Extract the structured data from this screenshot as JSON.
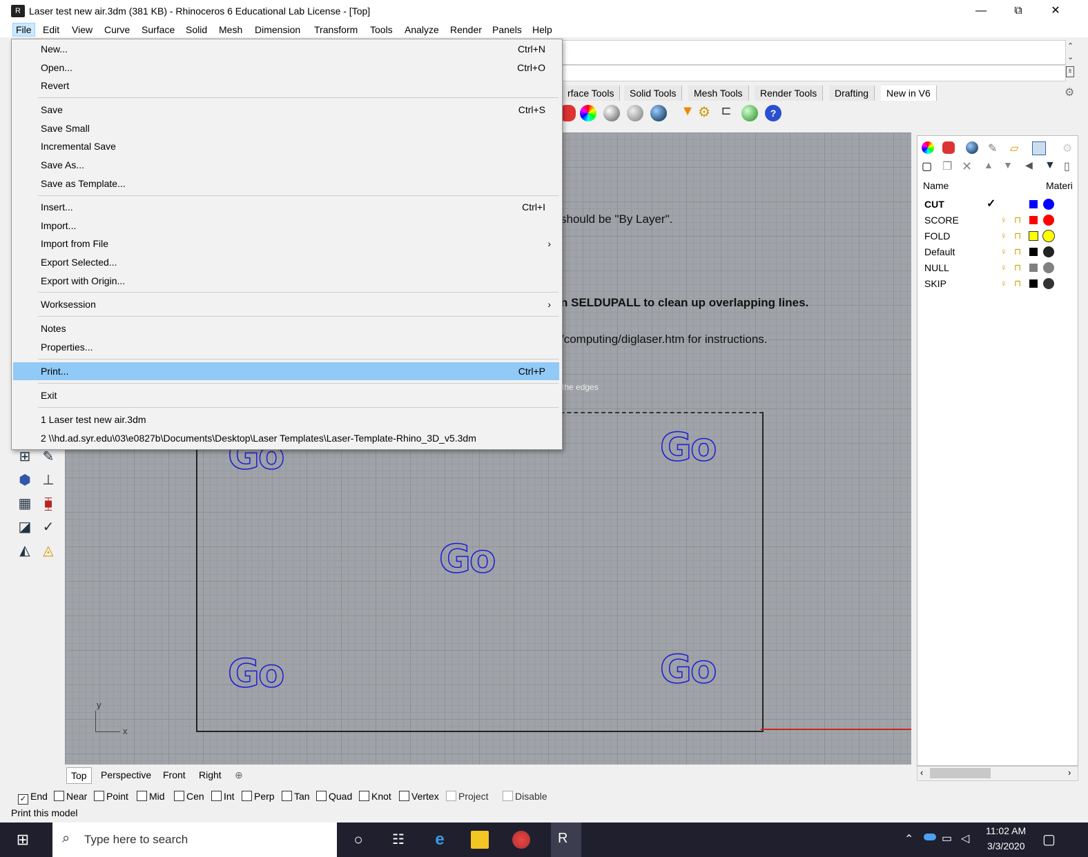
{
  "window": {
    "title": "Laser test new air.3dm (381 KB) - Rhinoceros 6 Educational Lab License - [Top]",
    "minimize": "—",
    "restore": "⧉",
    "close": "✕"
  },
  "menubar": [
    "File",
    "Edit",
    "View",
    "Curve",
    "Surface",
    "Solid",
    "Mesh",
    "Dimension",
    "Transform",
    "Tools",
    "Analyze",
    "Render",
    "Panels",
    "Help"
  ],
  "file_menu": {
    "items": [
      {
        "label": "New...",
        "shortcut": "Ctrl+N"
      },
      {
        "label": "Open...",
        "shortcut": "Ctrl+O"
      },
      {
        "label": "Revert",
        "shortcut": ""
      },
      {
        "label": "Save",
        "shortcut": "Ctrl+S"
      },
      {
        "label": "Save Small",
        "shortcut": ""
      },
      {
        "label": "Incremental Save",
        "shortcut": ""
      },
      {
        "label": "Save As...",
        "shortcut": ""
      },
      {
        "label": "Save as Template...",
        "shortcut": ""
      },
      {
        "label": "Insert...",
        "shortcut": "Ctrl+I"
      },
      {
        "label": "Import...",
        "shortcut": ""
      },
      {
        "label": "Import from File",
        "shortcut": "",
        "submenu": "›"
      },
      {
        "label": "Export Selected...",
        "shortcut": ""
      },
      {
        "label": "Export with Origin...",
        "shortcut": ""
      },
      {
        "label": "Worksession",
        "shortcut": "",
        "submenu": "›"
      },
      {
        "label": "Notes",
        "shortcut": ""
      },
      {
        "label": "Properties...",
        "shortcut": ""
      },
      {
        "label": "Print...",
        "shortcut": "Ctrl+P",
        "highlighted": true
      },
      {
        "label": "Exit",
        "shortcut": ""
      },
      {
        "label": "1 Laser test new air.3dm",
        "shortcut": ""
      },
      {
        "label": "2 \\\\hd.ad.syr.edu\\03\\e0827b\\Documents\\Desktop\\Laser Templates\\Laser-Template-Rhino_3D_v5.3dm",
        "shortcut": ""
      }
    ]
  },
  "toolbar_tabs": [
    "rface Tools",
    "Solid Tools",
    "Mesh Tools",
    "Render Tools",
    "Drafting",
    "New in V6"
  ],
  "viewport": {
    "notes": [
      "should be \"By Layer\".",
      "n SELDUPALL to clean up overlapping lines.",
      "/computing/diglaser.htm for instructions.",
      "the edges"
    ],
    "go_text": "Go",
    "axis_y": "y",
    "axis_x": "x"
  },
  "viewport_tabs": [
    "Top",
    "Perspective",
    "Front",
    "Right",
    "⊕"
  ],
  "osnaps": [
    {
      "label": "End",
      "checked": true
    },
    {
      "label": "Near",
      "checked": false
    },
    {
      "label": "Point",
      "checked": false
    },
    {
      "label": "Mid",
      "checked": false
    },
    {
      "label": "Cen",
      "checked": false
    },
    {
      "label": "Int",
      "checked": false
    },
    {
      "label": "Perp",
      "checked": false
    },
    {
      "label": "Tan",
      "checked": false
    },
    {
      "label": "Quad",
      "checked": false
    },
    {
      "label": "Knot",
      "checked": false
    },
    {
      "label": "Vertex",
      "checked": false
    },
    {
      "label": "Project",
      "checked": false
    },
    {
      "label": "Disable",
      "checked": false
    }
  ],
  "status_text": "Print this model",
  "layers": {
    "header_name": "Name",
    "header_material": "Materi",
    "rows": [
      {
        "name": "CUT",
        "color": "#0000ff",
        "current": true
      },
      {
        "name": "SCORE",
        "color": "#ff0000",
        "current": false
      },
      {
        "name": "FOLD",
        "color": "#ffff00",
        "current": false
      },
      {
        "name": "Default",
        "color": "#000000",
        "current": false
      },
      {
        "name": "NULL",
        "color": "#808080",
        "current": false
      },
      {
        "name": "SKIP",
        "color": "#000000",
        "current": false
      }
    ],
    "check_mark": "✓"
  },
  "taskbar": {
    "search_placeholder": "Type here to search",
    "time": "11:02 AM",
    "date": "3/3/2020"
  },
  "colors": {
    "menu_highlight": "#91c9f7",
    "go_outline": "#1a1ad8",
    "viewport_bg": "#a0a3a8"
  }
}
